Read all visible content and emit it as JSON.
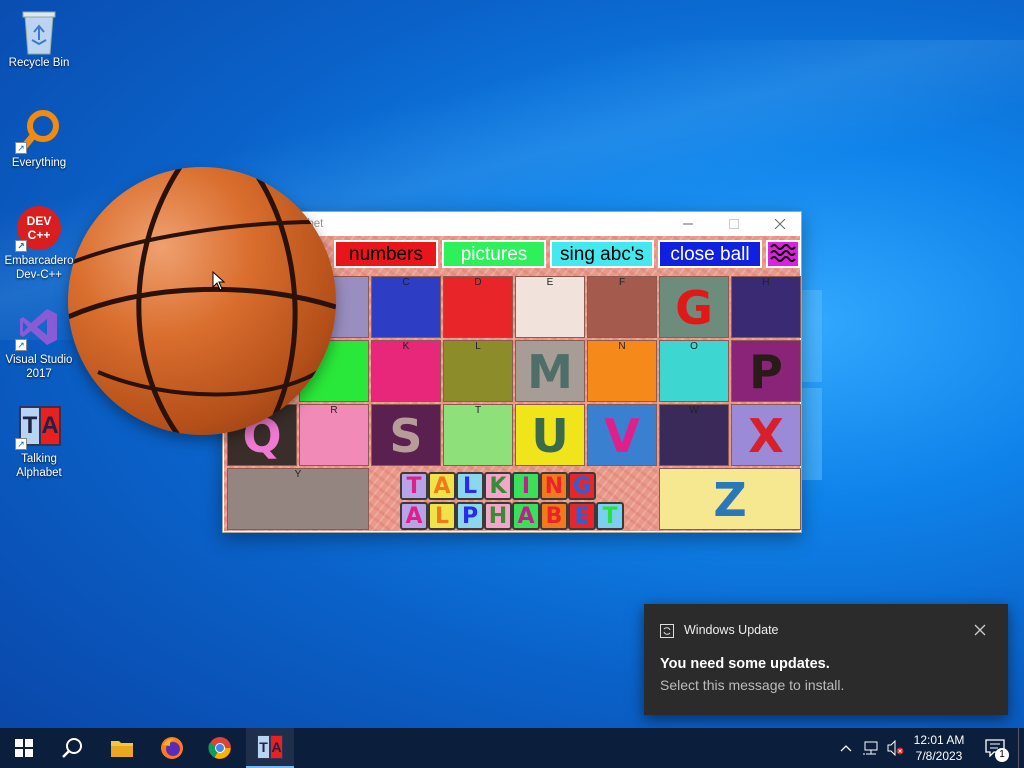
{
  "desktop": {
    "icons": [
      {
        "label": "Recycle Bin"
      },
      {
        "label": "Everything"
      },
      {
        "label": "Embarcadero Dev-C++",
        "badge": "DEV C++"
      },
      {
        "label": "Visual Studio 2017"
      },
      {
        "label": "Talking Alphabet"
      }
    ]
  },
  "app_window": {
    "title": "abet",
    "menu": {
      "numbers": "numbers",
      "pictures": "pictures",
      "sing": "sing abc's",
      "close_ball": "close ball"
    },
    "tiles": [
      {
        "small": "C",
        "big": "",
        "color": "#2d3dc4"
      },
      {
        "small": "D",
        "big": "",
        "color": "#e8262a"
      },
      {
        "small": "E",
        "big": "",
        "color": "#f2e2dc"
      },
      {
        "small": "F",
        "big": "",
        "color": "#a55a4e"
      },
      {
        "small": "",
        "big": "G",
        "color": "#6e8c7c",
        "big_color": "#e01818"
      },
      {
        "small": "H",
        "big": "",
        "color": "#3a2a74"
      },
      {
        "small": "K",
        "big": "",
        "color": "#e8267a"
      },
      {
        "small": "L",
        "big": "",
        "color": "#8c8c2a"
      },
      {
        "small": "",
        "big": "M",
        "color": "#a89c96",
        "big_color": "#4f6e6a"
      },
      {
        "small": "N",
        "big": "",
        "color": "#f58a1a"
      },
      {
        "small": "O",
        "big": "",
        "color": "#3ed6d0"
      },
      {
        "small": "",
        "big": "P",
        "color": "#8a2478",
        "big_color": "#2a1a1a"
      },
      {
        "small": "",
        "big": "Q",
        "color": "#3a2e2a",
        "big_color": "#f07ad2"
      },
      {
        "small": "R",
        "big": "",
        "color": "#f28ab8"
      },
      {
        "small": "",
        "big": "S",
        "color": "#5a2050",
        "big_color": "#b89c9a"
      },
      {
        "small": "T",
        "big": "",
        "color": "#8ee07a"
      },
      {
        "small": "",
        "big": "U",
        "color": "#f0e41a",
        "big_color": "#3a6a4a"
      },
      {
        "small": "",
        "big": "V",
        "color": "#3a80d0",
        "big_color": "#e0208a"
      },
      {
        "small": "W",
        "big": "",
        "color": "#3a2a5a"
      },
      {
        "small": "",
        "big": "X",
        "color": "#9a8ad8",
        "big_color": "#d8202a"
      },
      {
        "small": "Y",
        "big": "",
        "color": "#958580"
      },
      {
        "small": "",
        "big": "Z",
        "color": "#f6e890",
        "big_color": "#2a78b8"
      },
      {
        "small": "",
        "big": "",
        "color": "#9a9aa8"
      },
      {
        "small": "",
        "big": "",
        "color": "#2ae83a"
      }
    ],
    "logo_row1": [
      "T",
      "A",
      "L",
      "K",
      "I",
      "N",
      "G"
    ],
    "logo_row2": [
      "A",
      "L",
      "P",
      "H",
      "A",
      "B",
      "E",
      "T"
    ]
  },
  "notification": {
    "app": "Windows Update",
    "title": "You need some updates.",
    "body": "Select this message to install."
  },
  "taskbar": {
    "clock_time": "12:01 AM",
    "clock_date": "7/8/2023",
    "notification_count": "1"
  },
  "colors": {
    "numbers_bg": "#e8161a",
    "pictures_bg": "#2ef05a",
    "sing_bg": "#44e8ee",
    "close_ball_bg": "#1020e0",
    "toast_bg": "#2b2b2b",
    "taskbar_bg": "#0b1e3c"
  }
}
